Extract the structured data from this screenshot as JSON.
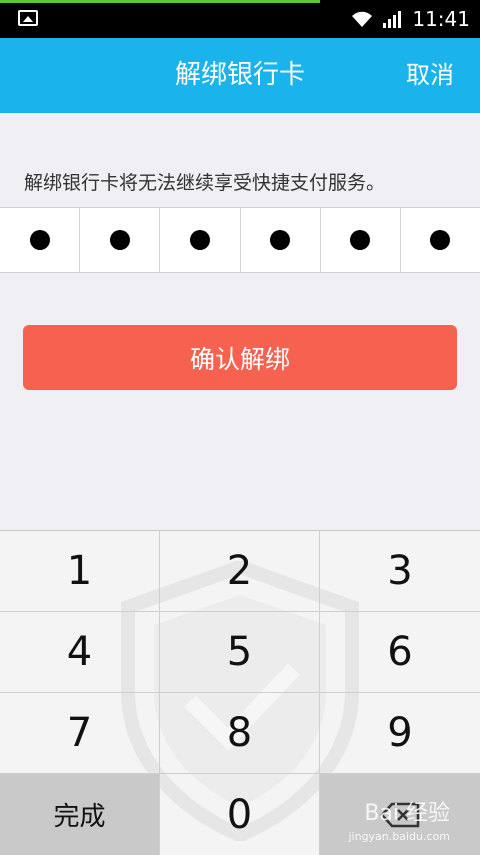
{
  "status_bar": {
    "time": "11:41"
  },
  "header": {
    "title": "解绑银行卡",
    "cancel_label": "取消"
  },
  "notice": "解绑银行卡将无法继续享受快捷支付服务。",
  "pin": {
    "length": 6,
    "filled": 6
  },
  "confirm_button": "确认解绑",
  "keypad": {
    "keys": [
      "1",
      "2",
      "3",
      "4",
      "5",
      "6",
      "7",
      "8",
      "9"
    ],
    "done_label": "完成",
    "zero_label": "0"
  },
  "watermark": {
    "text": "Bai 经验",
    "sub": "jingyan.baidu.com"
  }
}
